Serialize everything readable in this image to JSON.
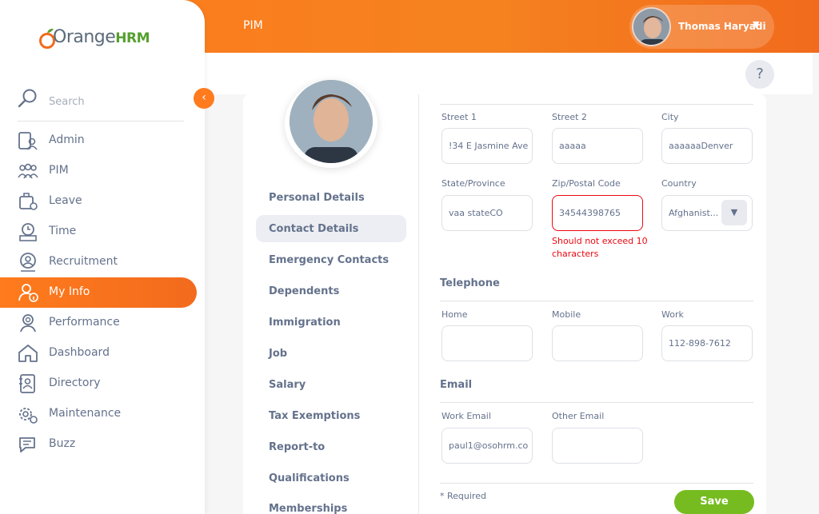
{
  "header": {
    "module_title": "PIM",
    "user_name": "Thomas Haryadi",
    "user_caret": "▼",
    "help_label": "?"
  },
  "logo": {
    "text_orange": "Orange",
    "text_hrm": "HRM"
  },
  "sidebar": {
    "search_placeholder": "Search",
    "collapse_glyph": "‹",
    "items": [
      {
        "label": "Admin",
        "icon": "admin-icon"
      },
      {
        "label": "PIM",
        "icon": "pim-icon"
      },
      {
        "label": "Leave",
        "icon": "leave-icon"
      },
      {
        "label": "Time",
        "icon": "time-icon"
      },
      {
        "label": "Recruitment",
        "icon": "recruitment-icon"
      },
      {
        "label": "My Info",
        "icon": "my-info-icon",
        "active": true
      },
      {
        "label": "Performance",
        "icon": "performance-icon"
      },
      {
        "label": "Dashboard",
        "icon": "dashboard-icon"
      },
      {
        "label": "Directory",
        "icon": "directory-icon"
      },
      {
        "label": "Maintenance",
        "icon": "maintenance-icon"
      },
      {
        "label": "Buzz",
        "icon": "buzz-icon"
      }
    ]
  },
  "tabs": [
    {
      "label": "Personal Details"
    },
    {
      "label": "Contact Details",
      "active": true
    },
    {
      "label": "Emergency Contacts"
    },
    {
      "label": "Dependents"
    },
    {
      "label": "Immigration"
    },
    {
      "label": "Job"
    },
    {
      "label": "Salary"
    },
    {
      "label": "Tax Exemptions"
    },
    {
      "label": "Report-to"
    },
    {
      "label": "Qualifications"
    },
    {
      "label": "Memberships"
    }
  ],
  "address": {
    "street1": {
      "label": "Street 1",
      "value": "!34 E Jasmine Ave"
    },
    "street2": {
      "label": "Street 2",
      "value": "aaaaa"
    },
    "city": {
      "label": "City",
      "value": "aaaaaaDenver"
    },
    "state": {
      "label": "State/Province",
      "value": "vaa stateCO"
    },
    "zip": {
      "label": "Zip/Postal Code",
      "value": "34544398765",
      "error": "Should not exceed 10 characters"
    },
    "country": {
      "label": "Country",
      "value": "Afghanist..."
    }
  },
  "telephone": {
    "title": "Telephone",
    "home": {
      "label": "Home",
      "value": ""
    },
    "mobile": {
      "label": "Mobile",
      "value": ""
    },
    "work": {
      "label": "Work",
      "value": "112-898-7612"
    }
  },
  "email": {
    "title": "Email",
    "work": {
      "label": "Work Email",
      "value": "paul1@osohrm.co"
    },
    "other": {
      "label": "Other Email",
      "value": ""
    }
  },
  "footer": {
    "required": "* Required",
    "save_label": "Save"
  },
  "colors": {
    "accent": "#ff7b1d",
    "save": "#76bc21",
    "error": "#eb0910"
  }
}
